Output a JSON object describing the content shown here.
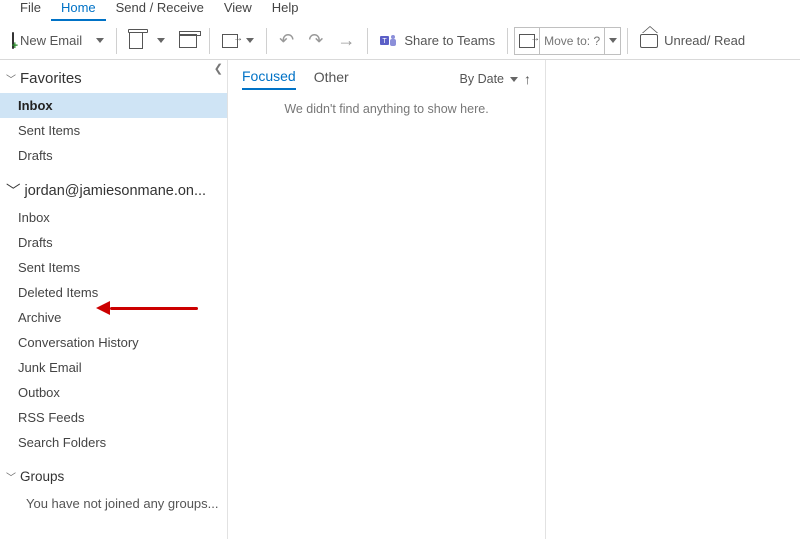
{
  "ribbon": {
    "tabs": [
      "File",
      "Home",
      "Send / Receive",
      "View",
      "Help"
    ],
    "active_index": 1
  },
  "toolbar": {
    "new_email": "New Email",
    "share_teams": "Share to Teams",
    "move_to_placeholder": "Move to: ?",
    "unread_read": "Unread/ Read"
  },
  "nav": {
    "favorites_label": "Favorites",
    "favorites": [
      "Inbox",
      "Sent Items",
      "Drafts"
    ],
    "favorites_selected_index": 0,
    "account_label": "jordan@jamiesonmane.on...",
    "account_folders": [
      "Inbox",
      "Drafts",
      "Sent Items",
      "Deleted Items",
      "Archive",
      "Conversation History",
      "Junk Email",
      "Outbox",
      "RSS Feeds",
      "Search Folders"
    ],
    "groups_label": "Groups",
    "groups_note": "You have not joined any groups..."
  },
  "list": {
    "tab_focused": "Focused",
    "tab_other": "Other",
    "sort_label": "By Date",
    "empty_message": "We didn't find anything to show here."
  }
}
